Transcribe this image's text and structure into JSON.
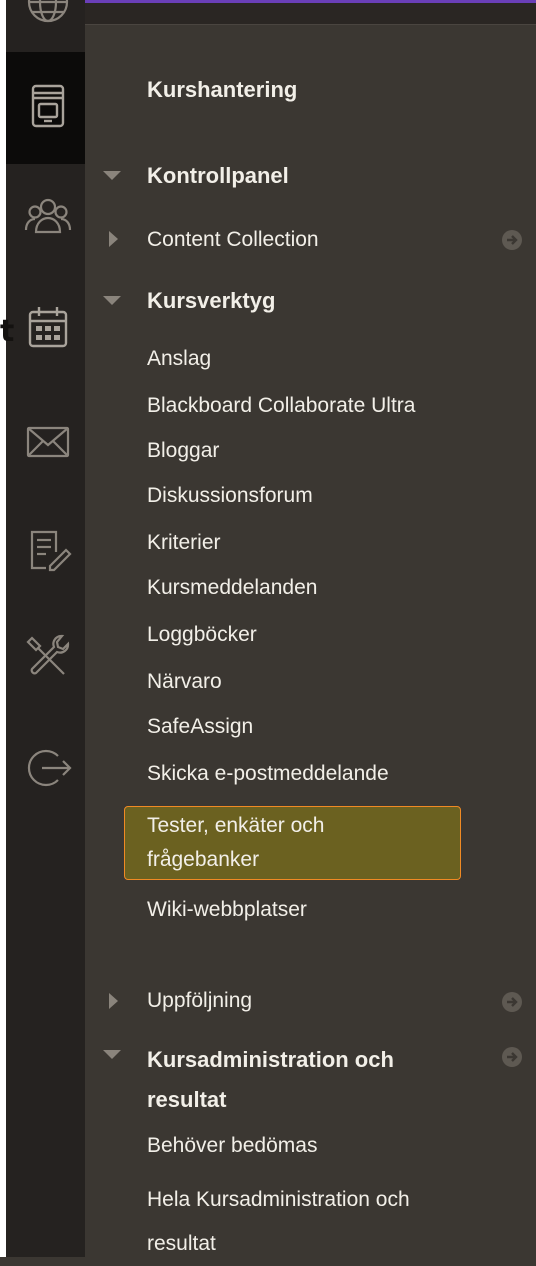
{
  "menu": {
    "title": "Kurshantering",
    "control_panel": "Kontrollpanel",
    "content_collection": "Content Collection",
    "course_tools": "Kursverktyg",
    "tools": [
      "Anslag",
      "Blackboard Collaborate Ultra",
      "Bloggar",
      "Diskussionsforum",
      "Kriterier",
      "Kursmeddelanden",
      "Loggböcker",
      "Närvaro",
      "SafeAssign",
      "Skicka e-postmeddelande"
    ],
    "highlighted_line1": "Tester, enkäter och",
    "highlighted_line2": "frågebanker",
    "wiki": "Wiki-webbplatser",
    "followup": "Uppföljning",
    "grade_center_line1": "Kursadministration och",
    "grade_center_line2": "resultat",
    "needs_grading": "Behöver bedömas",
    "full_grade_center_line1": "Hela Kursadministration och",
    "full_grade_center_line2": "resultat"
  },
  "rail": {
    "partial_letter": "t",
    "icons": [
      "globe-icon",
      "course-book-icon",
      "groups-icon",
      "calendar-icon",
      "mail-icon",
      "grades-edit-icon",
      "tools-icon",
      "sign-out-icon"
    ]
  },
  "colors": {
    "panel_bg": "#3b3732",
    "rail_bg": "#252220",
    "highlight_fill": "#6b6120",
    "highlight_border": "#f08a24",
    "accent": "#6a3fb8"
  }
}
